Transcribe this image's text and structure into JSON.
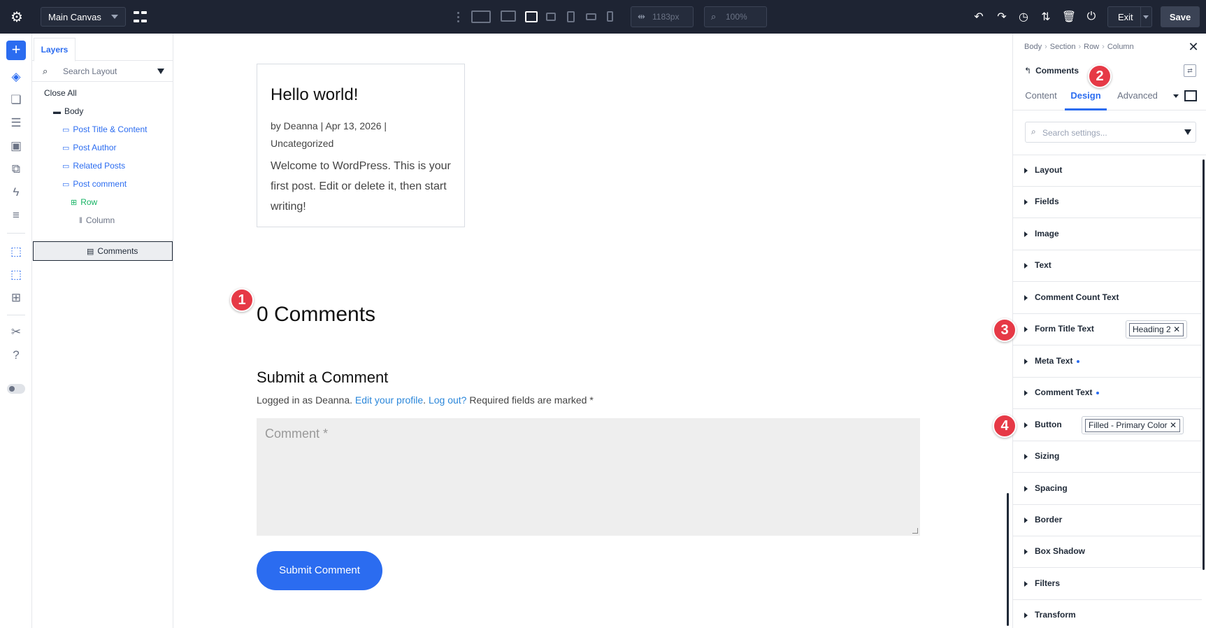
{
  "topbar": {
    "canvas_select": "Main Canvas",
    "width_value": "1183px",
    "zoom_value": "100%",
    "exit_label": "Exit",
    "save_label": "Save"
  },
  "layers": {
    "tab_label": "Layers",
    "search_placeholder": "Search Layout",
    "close_all": "Close All",
    "items": [
      {
        "label": "Body",
        "type": "body"
      },
      {
        "label": "Post Title & Content",
        "type": "module"
      },
      {
        "label": "Post Author",
        "type": "module"
      },
      {
        "label": "Related Posts",
        "type": "module"
      },
      {
        "label": "Post comment",
        "type": "module"
      },
      {
        "label": "Row",
        "type": "row"
      },
      {
        "label": "Column",
        "type": "column"
      },
      {
        "label": "Comments",
        "type": "module",
        "selected": true
      }
    ]
  },
  "canvas": {
    "post_title": "Hello world!",
    "post_meta_line1": "by Deanna | Apr 13, 2026 |",
    "post_meta_line2": "Uncategorized",
    "post_excerpt": "Welcome to WordPress. This is your first post. Edit or delete it, then start writing!",
    "comments_heading": "0 Comments",
    "submit_heading": "Submit a Comment",
    "logged_prefix": "Logged in as Deanna. ",
    "edit_profile_link": "Edit your profile",
    "logout_link": "Log out?",
    "required_text": " Required fields are marked *",
    "comment_placeholder": "Comment *",
    "submit_button": "Submit Comment"
  },
  "settings": {
    "breadcrumb": [
      "Body",
      "Section",
      "Row",
      "Column"
    ],
    "module_title": "Comments",
    "tabs": [
      "Content",
      "Design",
      "Advanced"
    ],
    "active_tab": "Design",
    "search_placeholder": "Search settings...",
    "groups": [
      {
        "label": "Layout"
      },
      {
        "label": "Fields"
      },
      {
        "label": "Image"
      },
      {
        "label": "Text"
      },
      {
        "label": "Comment Count Text"
      },
      {
        "label": "Form Title Text",
        "preset": "Heading 2"
      },
      {
        "label": "Meta Text",
        "modified": true
      },
      {
        "label": "Comment Text",
        "modified": true
      },
      {
        "label": "Button",
        "preset": "Filled - Primary Color"
      },
      {
        "label": "Sizing"
      },
      {
        "label": "Spacing"
      },
      {
        "label": "Border"
      },
      {
        "label": "Box Shadow"
      },
      {
        "label": "Filters"
      },
      {
        "label": "Transform"
      }
    ]
  },
  "markers": [
    "1",
    "2",
    "3",
    "4"
  ],
  "colors": {
    "topbar_bg": "#1e2433",
    "accent_blue": "#2b6cf0",
    "layer_green": "#16b364",
    "marker_red": "#e63946",
    "comment_field_bg": "#eeeeee"
  }
}
